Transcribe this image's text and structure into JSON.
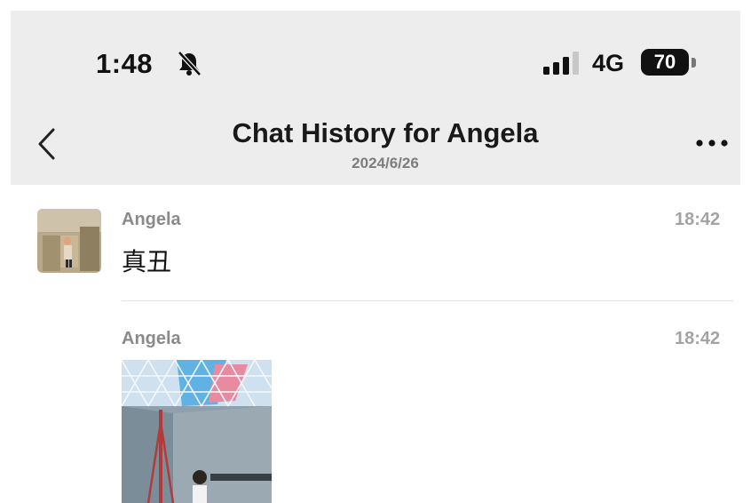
{
  "status_bar": {
    "time": "1:48",
    "network": "4G",
    "battery": "70",
    "icons": [
      "bell-off-icon",
      "signal-icon",
      "battery-icon"
    ]
  },
  "header": {
    "title": "Chat History for Angela",
    "date": "2024/6/26",
    "icons": [
      "back-icon",
      "more-icon"
    ]
  },
  "messages": [
    {
      "sender": "Angela",
      "time": "18:42",
      "text": "真丑"
    },
    {
      "sender": "Angela",
      "time": "18:42",
      "attachment": "photo"
    }
  ]
}
